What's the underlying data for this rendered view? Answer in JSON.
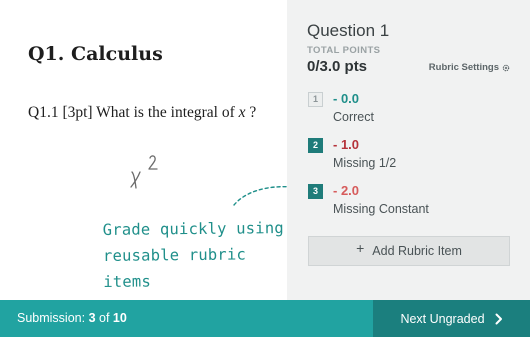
{
  "document": {
    "title": "Q1.  Calculus",
    "question_prefix": "Q1.1  [3pt] What is the integral of ",
    "question_variable": "x",
    "question_suffix": " ?",
    "handwritten_answer": "x²",
    "annotation_line1": "Grade quickly using",
    "annotation_line2": "reusable rubric items"
  },
  "rubric_panel": {
    "question_title": "Question 1",
    "total_points_label": "TOTAL POINTS",
    "total_points_value": "0/3.0 pts",
    "settings_label": "Rubric Settings",
    "settings_icon": "gear-icon",
    "items": [
      {
        "key": "1",
        "points": "- 0.0",
        "description": "Correct",
        "points_color": "#1f8f8a",
        "selected": false
      },
      {
        "key": "2",
        "points": "- 1.0",
        "description": "Missing 1/2",
        "points_color": "#b5323a",
        "selected": true
      },
      {
        "key": "3",
        "points": "- 2.0",
        "description": "Missing Constant",
        "points_color": "#d65b5b",
        "selected": true
      }
    ],
    "add_item_icon": "+",
    "add_item_label": "Add Rubric Item"
  },
  "footer": {
    "submission_label": "Submission: ",
    "submission_current": "3",
    "submission_of": " of ",
    "submission_total": "10",
    "next_label": "Next Ungraded",
    "next_icon": "chevron-right-icon"
  },
  "colors": {
    "accent": "#21a3a1",
    "accent_dark": "#1b7f7e",
    "annotation": "#1f8f8a",
    "selected_key": "#1f7c7a"
  }
}
